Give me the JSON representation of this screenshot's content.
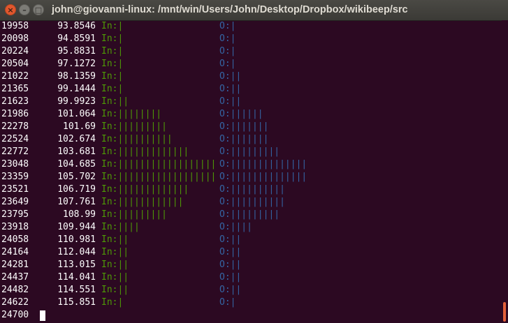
{
  "window": {
    "title": "john@giovanni-linux: /mnt/win/Users/John/Desktop/Dropbox/wikibeep/src",
    "close_glyph": "×",
    "minimize_glyph": "–",
    "maximize_glyph": "□"
  },
  "colors": {
    "background": "#2c0922",
    "text": "#ffffff",
    "in_bars": "#4e9a06",
    "out_bars": "#3465a4"
  },
  "terminal": {
    "rows": [
      {
        "id": "19958",
        "value": "93.8546",
        "in": "In:|",
        "out": "O:|"
      },
      {
        "id": "20098",
        "value": "94.8591",
        "in": "In:|",
        "out": "O:|"
      },
      {
        "id": "20224",
        "value": "95.8831",
        "in": "In:|",
        "out": "O:|"
      },
      {
        "id": "20504",
        "value": "97.1272",
        "in": "In:|",
        "out": "O:|"
      },
      {
        "id": "21022",
        "value": "98.1359",
        "in": "In:|",
        "out": "O:||"
      },
      {
        "id": "21365",
        "value": "99.1444",
        "in": "In:|",
        "out": "O:||"
      },
      {
        "id": "21623",
        "value": "99.9923",
        "in": "In:||",
        "out": "O:||"
      },
      {
        "id": "21986",
        "value": "101.064",
        "in": "In:||||||||",
        "out": "O:||||||"
      },
      {
        "id": "22278",
        "value": "101.69",
        "in": "In:|||||||||",
        "out": "O:|||||||"
      },
      {
        "id": "22524",
        "value": "102.674",
        "in": "In:||||||||||",
        "out": "O:|||||||"
      },
      {
        "id": "22772",
        "value": "103.681",
        "in": "In:|||||||||||||",
        "out": "O:|||||||||"
      },
      {
        "id": "23048",
        "value": "104.685",
        "in": "In:||||||||||||||||||",
        "out": "O:||||||||||||||"
      },
      {
        "id": "23359",
        "value": "105.702",
        "in": "In:||||||||||||||||||",
        "out": "O:||||||||||||||"
      },
      {
        "id": "23521",
        "value": "106.719",
        "in": "In:|||||||||||||",
        "out": "O:||||||||||"
      },
      {
        "id": "23649",
        "value": "107.761",
        "in": "In:||||||||||||",
        "out": "O:||||||||||"
      },
      {
        "id": "23795",
        "value": "108.99",
        "in": "In:|||||||||",
        "out": "O:|||||||||"
      },
      {
        "id": "23918",
        "value": "109.944",
        "in": "In:||||",
        "out": "O:||||"
      },
      {
        "id": "24058",
        "value": "110.981",
        "in": "In:||",
        "out": "O:||"
      },
      {
        "id": "24164",
        "value": "112.044",
        "in": "In:||",
        "out": "O:||"
      },
      {
        "id": "24281",
        "value": "113.015",
        "in": "In:||",
        "out": "O:||"
      },
      {
        "id": "24437",
        "value": "114.041",
        "in": "In:||",
        "out": "O:||"
      },
      {
        "id": "24482",
        "value": "114.551",
        "in": "In:||",
        "out": "O:||"
      },
      {
        "id": "24622",
        "value": "115.851",
        "in": "In:|",
        "out": "O:|"
      }
    ],
    "prompt_text": "24700"
  }
}
